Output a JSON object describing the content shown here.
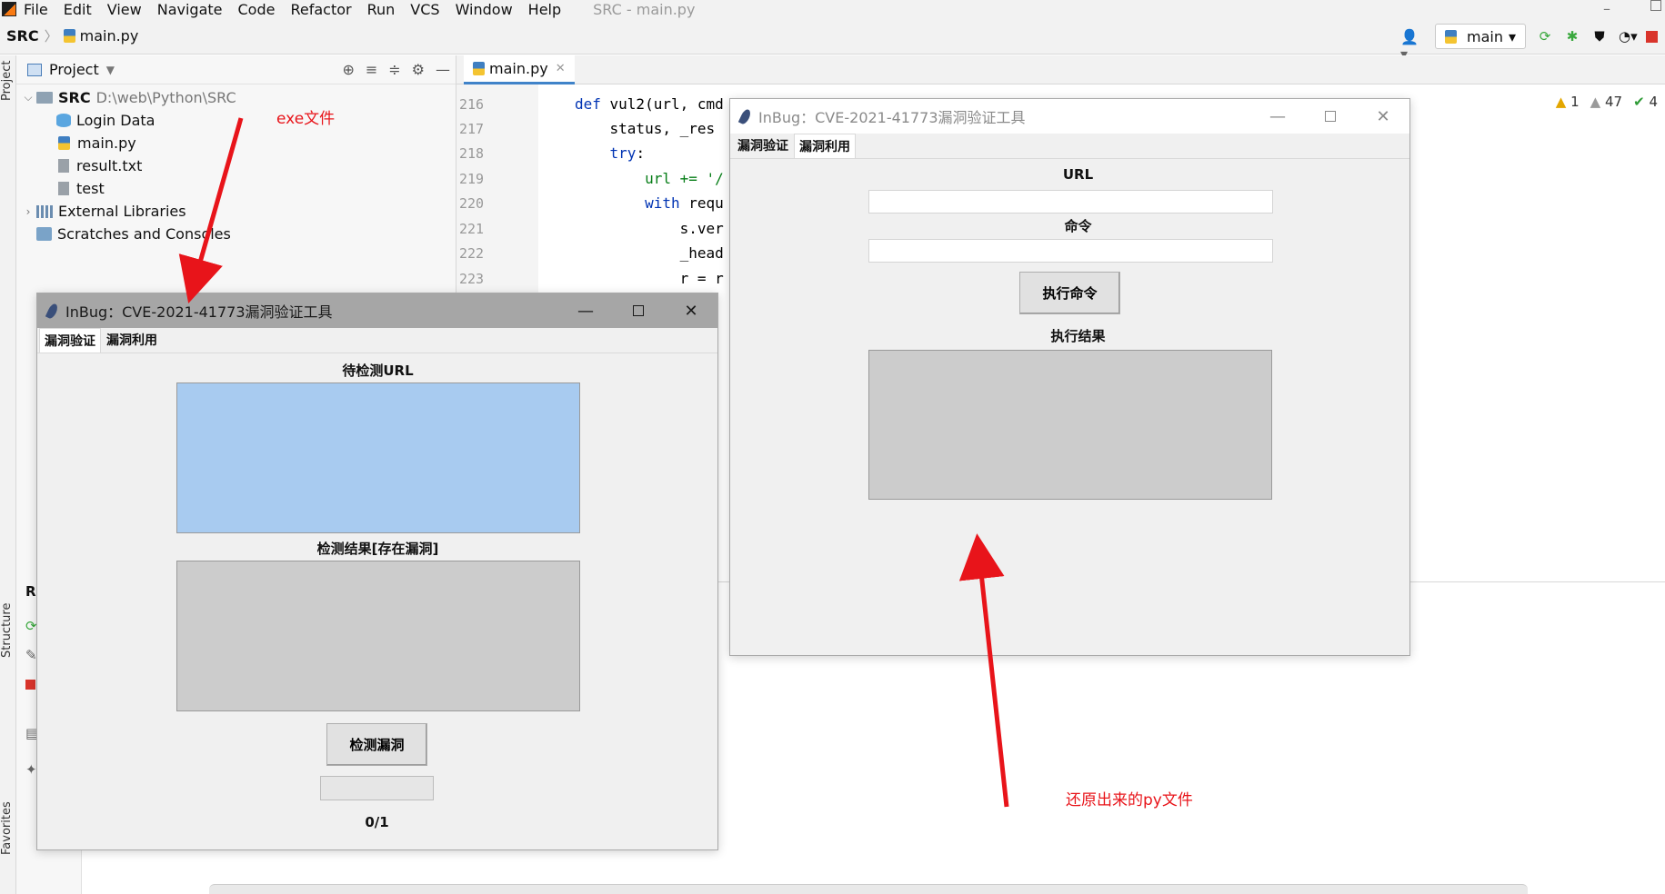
{
  "menu": {
    "items": [
      "File",
      "Edit",
      "View",
      "Navigate",
      "Code",
      "Refactor",
      "Run",
      "VCS",
      "Window",
      "Help"
    ],
    "window_title": "SRC - main.py"
  },
  "navbar": {
    "project": "SRC",
    "file": "main.py",
    "run_config": "main"
  },
  "side_labels": {
    "project": "Project",
    "structure": "Structure",
    "favorites": "Favorites"
  },
  "project_panel": {
    "title": "Project",
    "root_name": "SRC",
    "root_path": "D:\\web\\Python\\SRC",
    "files": [
      "Login Data",
      "main.py",
      "result.txt",
      "test"
    ],
    "external": "External Libraries",
    "scratches": "Scratches and Consoles"
  },
  "editor": {
    "tab": "main.py",
    "line_numbers": [
      "216",
      "217",
      "218",
      "219",
      "220",
      "221",
      "222",
      "223"
    ],
    "code": [
      {
        "kw": "def ",
        "rest": "vul2(url, cmd"
      },
      {
        "kw": "",
        "rest": "    status, _res"
      },
      {
        "kw": "    try",
        "rest": ":"
      },
      {
        "kw": "",
        "rest": "        url += '/"
      },
      {
        "kw": "        with ",
        "rest": "requ"
      },
      {
        "kw": "",
        "rest": "            s.ver"
      },
      {
        "kw": "",
        "rest": "            _head"
      },
      {
        "kw": "",
        "rest": "            r = r"
      }
    ],
    "problems": {
      "warnings": "1",
      "weak": "47",
      "ok": "4"
    }
  },
  "verify_window": {
    "title": "InBug：CVE-2021-41773漏洞验证工具",
    "tabs": [
      "漏洞验证",
      "漏洞利用"
    ],
    "url_label": "待检测URL",
    "result_label": "检测结果[存在漏洞]",
    "check_button": "检测漏洞",
    "progress_text": "0/1",
    "progress": 0
  },
  "exploit_window": {
    "title": "InBug：CVE-2021-41773漏洞验证工具",
    "tabs": [
      "漏洞验证",
      "漏洞利用"
    ],
    "url_label": "URL",
    "cmd_label": "命令",
    "exec_button": "执行命令",
    "result_label": "执行结果"
  },
  "annotations": {
    "exe": "exe文件",
    "py": "还原出来的py文件"
  },
  "colors": {
    "accent": "#4083c9",
    "annotation": "#e8141a",
    "url_box": "#a8cbf0",
    "result_box": "#cccccc"
  }
}
